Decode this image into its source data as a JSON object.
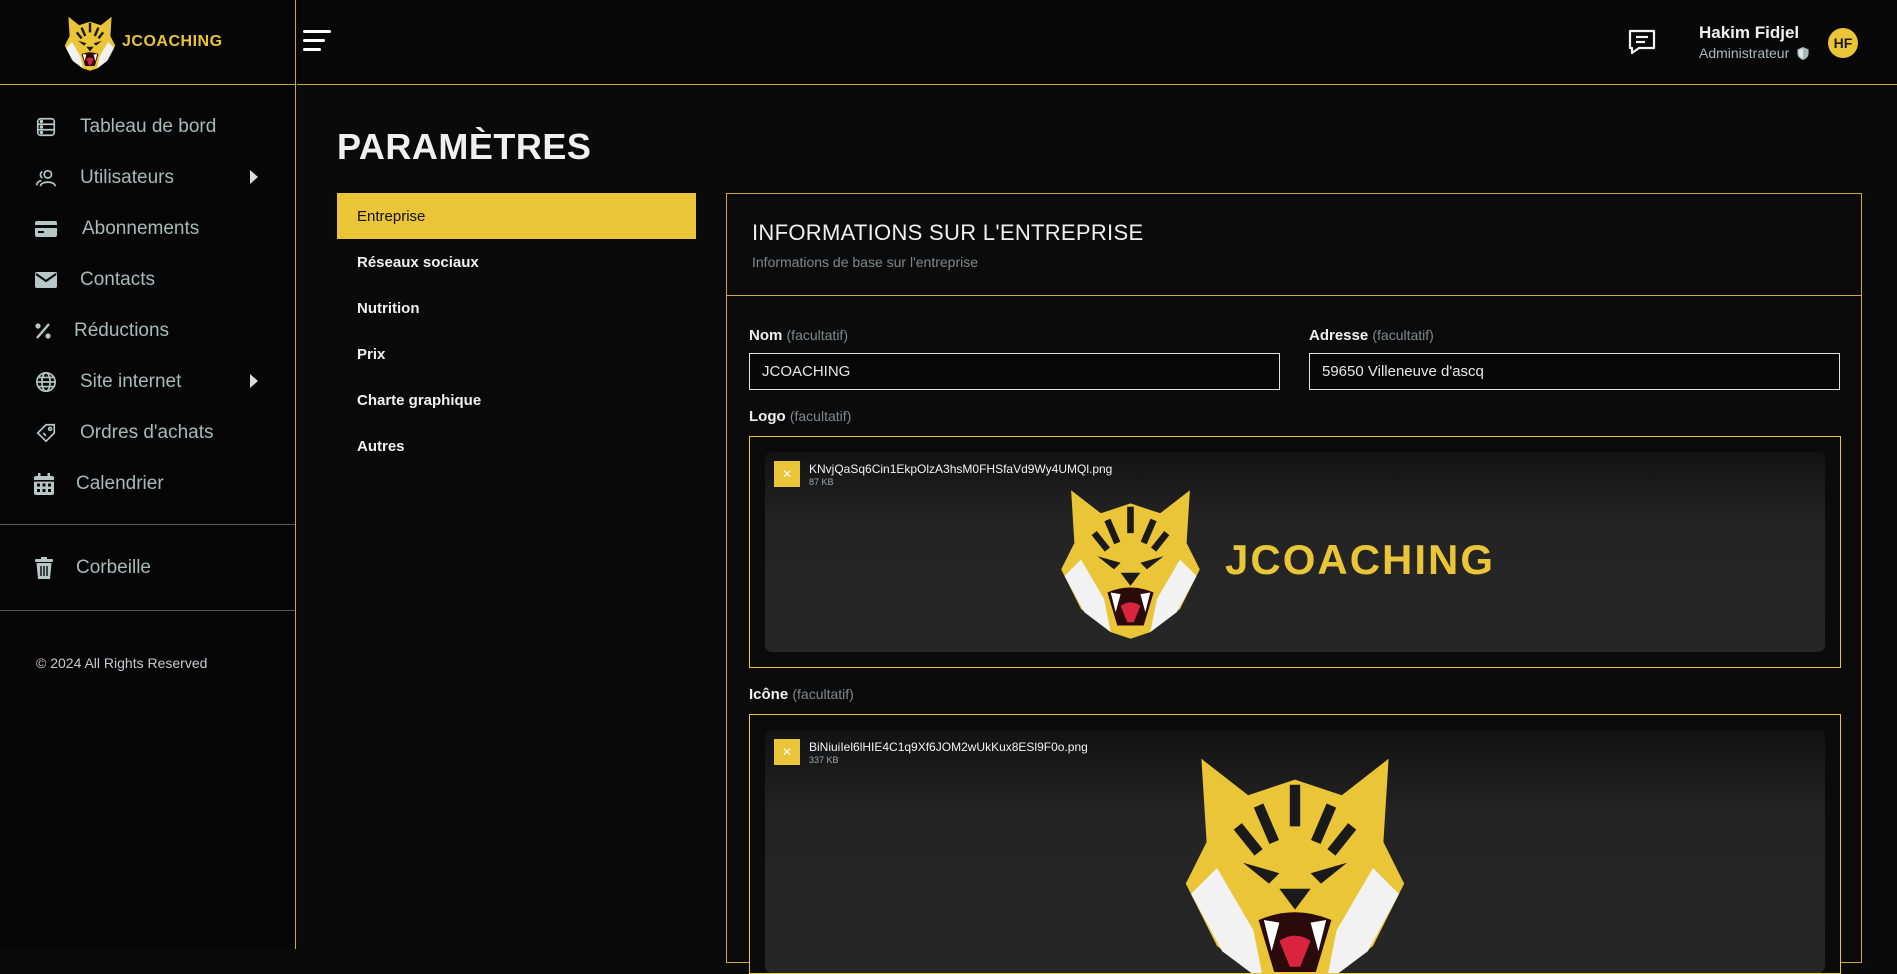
{
  "brand": {
    "name": "JCOACHING"
  },
  "sidebar": {
    "items": [
      {
        "label": "Tableau de bord",
        "icon": "dashboard-icon"
      },
      {
        "label": "Utilisateurs",
        "icon": "users-icon",
        "has_submenu": true
      },
      {
        "label": "Abonnements",
        "icon": "credit-card-icon"
      },
      {
        "label": "Contacts",
        "icon": "envelope-icon"
      },
      {
        "label": "Réductions",
        "icon": "percent-icon"
      },
      {
        "label": "Site internet",
        "icon": "globe-icon",
        "has_submenu": true
      },
      {
        "label": "Ordres d'achats",
        "icon": "tag-icon"
      },
      {
        "label": "Calendrier",
        "icon": "calendar-icon"
      }
    ],
    "trash": {
      "label": "Corbeille",
      "icon": "trash-icon"
    },
    "copyright": "© 2024 All Rights Reserved"
  },
  "header": {
    "user": {
      "name": "Hakim Fidjel",
      "role": "Administrateur",
      "initials": "HF"
    }
  },
  "page": {
    "title": "PARAMÈTRES"
  },
  "settings_nav": {
    "items": [
      "Entreprise",
      "Réseaux sociaux",
      "Nutrition",
      "Prix",
      "Charte graphique",
      "Autres"
    ],
    "active": "Entreprise"
  },
  "panel": {
    "title": "INFORMATIONS SUR L'ENTREPRISE",
    "subtitle": "Informations de base sur l'entreprise",
    "optional_label": "(facultatif)",
    "fields": {
      "nom": {
        "label": "Nom",
        "value": "JCOACHING"
      },
      "adresse": {
        "label": "Adresse",
        "value": "59650 Villeneuve d'ascq"
      },
      "logo": {
        "label": "Logo",
        "file_name": "KNvjQaSq6Cin1EkpOlzA3hsM0FHSfaVd9Wy4UMQl.png",
        "file_size": "87 KB",
        "remove_label": "✕"
      },
      "icone": {
        "label": "Icône",
        "file_name": "BiNiuiIel6lHIE4C1q9Xf6JOM2wUkKux8ESl9F0o.png",
        "file_size": "337 KB",
        "remove_label": "✕"
      }
    },
    "logo_preview_text": "JCOACHING"
  },
  "colors": {
    "accent": "#e9c537",
    "background": "#0a0a0a",
    "border": "#c9a93a"
  }
}
